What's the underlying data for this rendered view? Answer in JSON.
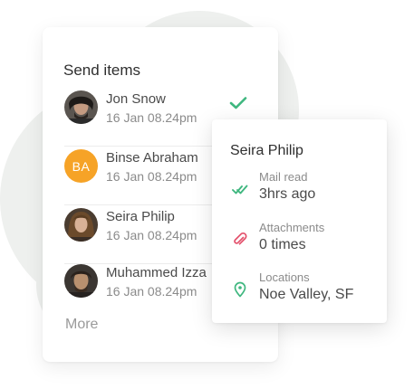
{
  "send_items": {
    "title": "Send items",
    "contacts": [
      {
        "name": "Jon Snow",
        "time": "16 Jan 08.24pm",
        "avatar": "photo",
        "avatar_icon": "person-photo-icon",
        "status_icon": "check-icon",
        "status_color": "#3fb77f"
      },
      {
        "name": "Binse Abraham",
        "time": "16 Jan 08.24pm",
        "avatar": "initials",
        "initials": "BA",
        "avatar_color": "#f6a327"
      },
      {
        "name": "Seira Philip",
        "time": "16 Jan 08.24pm",
        "avatar": "photo",
        "avatar_icon": "person-photo-icon"
      },
      {
        "name": "Muhammed Izza",
        "time": "16 Jan 08.24pm",
        "avatar": "photo",
        "avatar_icon": "person-photo-icon"
      }
    ],
    "more_label": "More"
  },
  "detail": {
    "name": "Seira Philip",
    "stats": [
      {
        "label": "Mail read",
        "value": "3hrs ago",
        "icon": "double-check-icon",
        "color": "#3fb77f"
      },
      {
        "label": "Attachments",
        "value": "0 times",
        "icon": "paperclip-icon",
        "color": "#e3506b"
      },
      {
        "label": "Locations",
        "value": "Noe Valley, SF",
        "icon": "map-pin-icon",
        "color": "#3fb77f"
      }
    ]
  }
}
